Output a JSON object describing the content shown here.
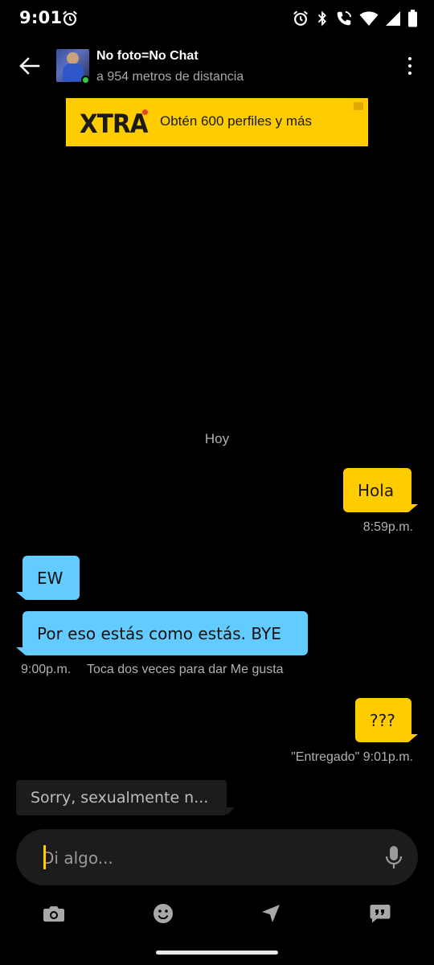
{
  "status_bar": {
    "time": "9:01",
    "icons": [
      "alarm-icon",
      "alarm-icon",
      "bluetooth-icon",
      "wifi-call-icon",
      "wifi-icon",
      "signal-icon",
      "battery-icon"
    ]
  },
  "header": {
    "profile_name": "No foto=No Chat",
    "distance": "a 954 metros de distancia",
    "online": true,
    "online_color": "#2ecc40"
  },
  "banner": {
    "logo": "XTRA",
    "text": "Obtén 600 perfiles y más",
    "color": "#ffcc00"
  },
  "chat": {
    "date_label": "Hoy",
    "messages": [
      {
        "direction": "out",
        "text": "Hola"
      },
      {
        "direction": "in",
        "text": "EW"
      },
      {
        "direction": "in",
        "text": "Por eso estás como estás. BYE"
      },
      {
        "direction": "out",
        "text": "???"
      }
    ],
    "meta": {
      "hola_time": "8:59p.m.",
      "in_time": "9:00p.m.",
      "like_hint": "Toca dos veces para dar Me gusta",
      "delivered": "\"Entregado\" 9:01p.m."
    },
    "typing_preview": "Sorry, sexualmente n...",
    "colors": {
      "outgoing": "#ffcc00",
      "incoming": "#62cbff"
    }
  },
  "input": {
    "placeholder": "Di algo..."
  },
  "toolbar": {
    "buttons": [
      "camera-icon",
      "emoji-icon",
      "location-icon",
      "saved-phrases-icon"
    ]
  }
}
